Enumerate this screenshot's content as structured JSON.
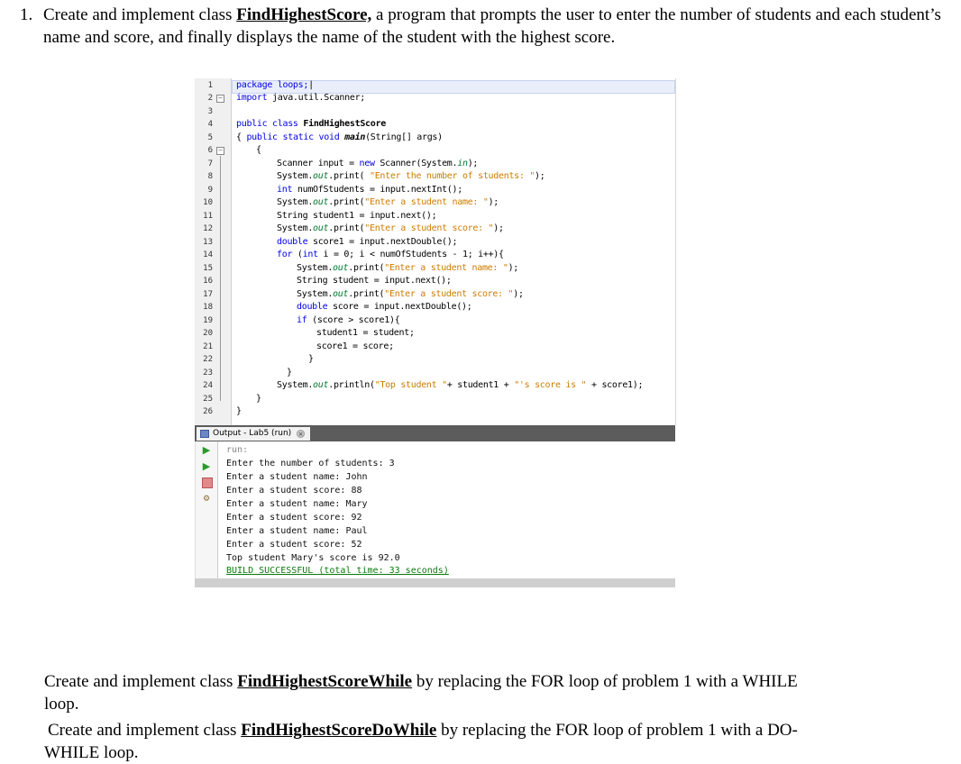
{
  "question1": {
    "number": "1.",
    "pre": "Create and implement class ",
    "class_name": "FindHighestScore,",
    "post": " a program that prompts the user to enter the number of students and each student’s name and score, and finally displays the name of the student with the highest score."
  },
  "editor": {
    "line_numbers": [
      "1",
      "2",
      "3",
      "4",
      "5",
      "6",
      "7",
      "8",
      "9",
      "10",
      "11",
      "12",
      "13",
      "14",
      "15",
      "16",
      "17",
      "18",
      "19",
      "20",
      "21",
      "22",
      "23",
      "24",
      "25",
      "26"
    ],
    "line1": "package loops;",
    "line2_kw": "import",
    "line2_rest": " java.util.Scanner;",
    "line4_kw": "public class",
    "line4_cls": "FindHighestScore",
    "line5_a": "{ ",
    "line5_kw": "public static void",
    "line5_m": "main",
    "line5_rest": "(String[] args)",
    "brace_open": "{",
    "l7_a": "Scanner input = ",
    "l7_kw": "new",
    "l7_b": " Scanner(System.",
    "l7_it": "in",
    "l7_c": ");",
    "sys": "System.",
    "out": "out",
    "print": ".print(",
    "println": ".println(",
    "l8_str": " \"Enter the number of students: \"",
    "close": ");",
    "l9_kw": "int",
    "l9_rest": " numOfStudents = input.nextInt();",
    "l10_str": "\"Enter a student name: \"",
    "l11": "String student1 = input.next();",
    "l12_str": "\"Enter a student score: \"",
    "l13_kw": "double",
    "l13_rest": " score1 = input.nextDouble();",
    "l14_kw": "for",
    "l14_a": " (",
    "l14_kw2": "int",
    "l14_rest": " i = 0; i < numOfStudents - 1; i++){",
    "l16": "String student = input.next();",
    "l18_rest": " score = input.nextDouble();",
    "l19_kw": "if",
    "l19_rest": " (score > score1){",
    "l20": "student1 = student;",
    "l21": "score1 = score;",
    "brace_close": "}",
    "l24_str1": "\"Top student \"",
    "l24_mid": "+ student1 + ",
    "l24_str2": "\"'s score is \"",
    "l24_end": " + score1);"
  },
  "output": {
    "tab_label": "Output - Lab5 (run)",
    "close_glyph": "×",
    "lines": [
      "run:",
      "Enter the number of students: 3",
      "Enter a student name: John",
      "Enter a student score: 88",
      "Enter a student name: Mary",
      "Enter a student score: 92",
      "Enter a student name: Paul",
      "Enter a student score: 52",
      "Top student Mary's score is 92.0",
      "BUILD SUCCESSFUL (total time: 33 seconds)"
    ]
  },
  "question2": {
    "pre": "Create and implement class ",
    "class_name": "FindHighestScoreWhile",
    "post": " by replacing the FOR loop of problem 1 with a WHILE",
    "post2": "loop."
  },
  "question3": {
    "pre": "Create and implement class ",
    "class_name": "FindHighestScoreDoWhile",
    "post": " by replacing the FOR loop of problem 1 with a DO-",
    "post2": "WHILE loop."
  }
}
